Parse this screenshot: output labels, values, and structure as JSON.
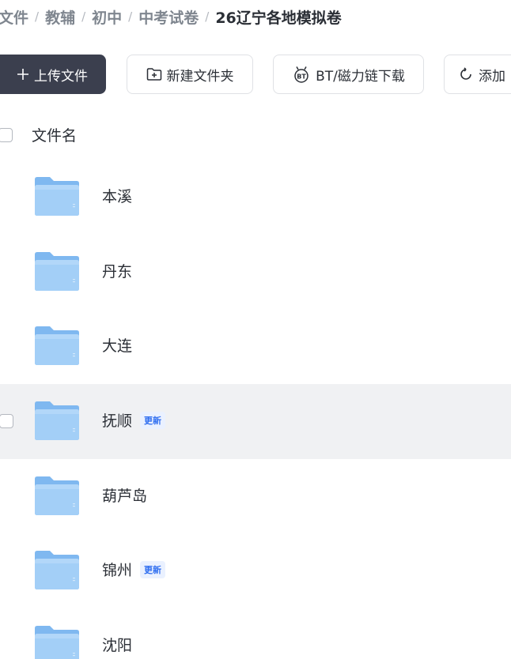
{
  "breadcrumb": {
    "items": [
      "文件",
      "教辅",
      "初中",
      "中考试卷",
      "26辽宁各地模拟卷"
    ],
    "separator": "/"
  },
  "toolbar": {
    "upload_label": "上传文件",
    "new_folder_label": "新建文件夹",
    "bt_label": "BT/磁力链下载",
    "add_label": "添加"
  },
  "list": {
    "header": {
      "name_column": "文件名"
    },
    "folders": [
      {
        "name": "本溪",
        "badge": "",
        "selected": false
      },
      {
        "name": "丹东",
        "badge": "",
        "selected": false
      },
      {
        "name": "大连",
        "badge": "",
        "selected": false
      },
      {
        "name": "抚顺",
        "badge": "更新",
        "selected": true
      },
      {
        "name": "葫芦岛",
        "badge": "",
        "selected": false
      },
      {
        "name": "锦州",
        "badge": "更新",
        "selected": false
      },
      {
        "name": "沈阳",
        "badge": "",
        "selected": false
      }
    ]
  },
  "icons": {
    "upload": "plus-icon",
    "new_folder": "folder-plus-icon",
    "bt": "bt-magnet-icon",
    "add": "refresh-icon",
    "folder": "folder-icon"
  },
  "colors": {
    "primary_button": "#3b3f4e",
    "folder": "#8cc3f4",
    "badge_text": "#2f6ef0",
    "badge_bg": "#eaf1ff",
    "selected_row": "#f0f1f3"
  }
}
